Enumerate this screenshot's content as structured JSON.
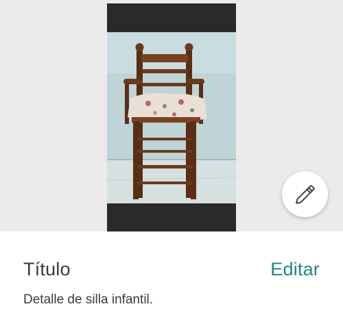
{
  "photo": {
    "subject": "wooden-high-chair",
    "background_color": "#ebebeb",
    "letterbox_color": "#2a2a28"
  },
  "edit_fab": {
    "icon": "pencil-icon"
  },
  "details": {
    "title_label": "Título",
    "edit_label": "Editar",
    "description": "Detalle de silla infantil."
  },
  "colors": {
    "accent": "#1f8a7e",
    "text": "#3a3a3a"
  }
}
